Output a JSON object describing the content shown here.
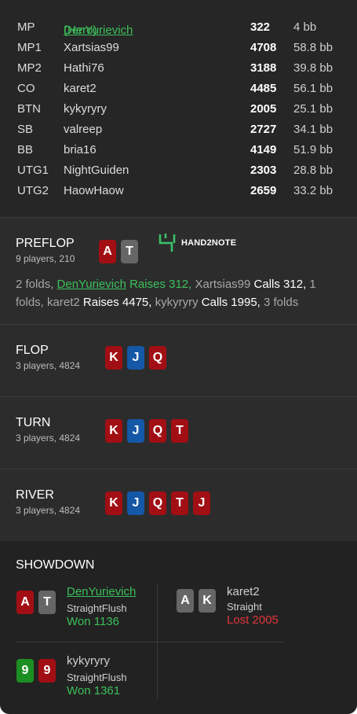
{
  "players": [
    {
      "pos": "MP",
      "name": "DenYurievich",
      "hero_tag": "(Hero)",
      "stack": "322",
      "bb": "4 bb"
    },
    {
      "pos": "MP1",
      "name": "Xartsias99",
      "stack": "4708",
      "bb": "58.8 bb"
    },
    {
      "pos": "MP2",
      "name": "Hathi76",
      "stack": "3188",
      "bb": "39.8 bb"
    },
    {
      "pos": "CO",
      "name": "karet2",
      "stack": "4485",
      "bb": "56.1 bb"
    },
    {
      "pos": "BTN",
      "name": "kykyryry",
      "stack": "2005",
      "bb": "25.1 bb"
    },
    {
      "pos": "SB",
      "name": "valreep",
      "stack": "2727",
      "bb": "34.1 bb"
    },
    {
      "pos": "BB",
      "name": "bria16",
      "stack": "4149",
      "bb": "51.9 bb"
    },
    {
      "pos": "UTG1",
      "name": "NightGuiden",
      "stack": "2303",
      "bb": "28.8 bb"
    },
    {
      "pos": "UTG2",
      "name": "HaowHaow",
      "stack": "2659",
      "bb": "33.2 bb"
    }
  ],
  "preflop": {
    "title": "PREFLOP",
    "sub": "9 players, 210",
    "cards": [
      "A",
      "T"
    ],
    "logo_text": "HAND2NOTE",
    "actions": {
      "a1": "2 folds, ",
      "a2_name": "DenYurievich",
      "a3": " Raises 312,",
      "a4": " Xartsias99 ",
      "a5": "Calls 312,",
      "a6": " 1 folds, karet2 ",
      "a7": "Raises 4475,",
      "a8": " kykyryry ",
      "a9": "Calls 1995,",
      "a10": " 3 folds"
    }
  },
  "flop": {
    "title": "FLOP",
    "sub": "3 players, 4824",
    "cards": [
      "K",
      "J",
      "Q"
    ]
  },
  "turn": {
    "title": "TURN",
    "sub": "3 players, 4824",
    "cards": [
      "K",
      "J",
      "Q",
      "T"
    ]
  },
  "river": {
    "title": "RIVER",
    "sub": "3 players, 4824",
    "cards": [
      "K",
      "J",
      "Q",
      "T",
      "J"
    ]
  },
  "showdown": {
    "title": "SHOWDOWN",
    "players": [
      {
        "cards": [
          "A",
          "T"
        ],
        "name": "DenYurievich",
        "hand": "StraightFlush",
        "result": "Won 1136"
      },
      {
        "cards": [
          "A",
          "K"
        ],
        "name": "karet2",
        "hand": "Straight",
        "result": "Lost 2005"
      },
      {
        "cards": [
          "9",
          "9"
        ],
        "name": "kykyryry",
        "hand": "StraightFlush",
        "result": "Won 1361"
      }
    ]
  },
  "colors": {
    "background": "#262626",
    "hero_green": "#3cc05a",
    "card_red": "#a10f14",
    "card_blue": "#1558a8",
    "card_gray": "#666666",
    "card_green": "#1d8f22",
    "lost_red": "#e0353b"
  }
}
